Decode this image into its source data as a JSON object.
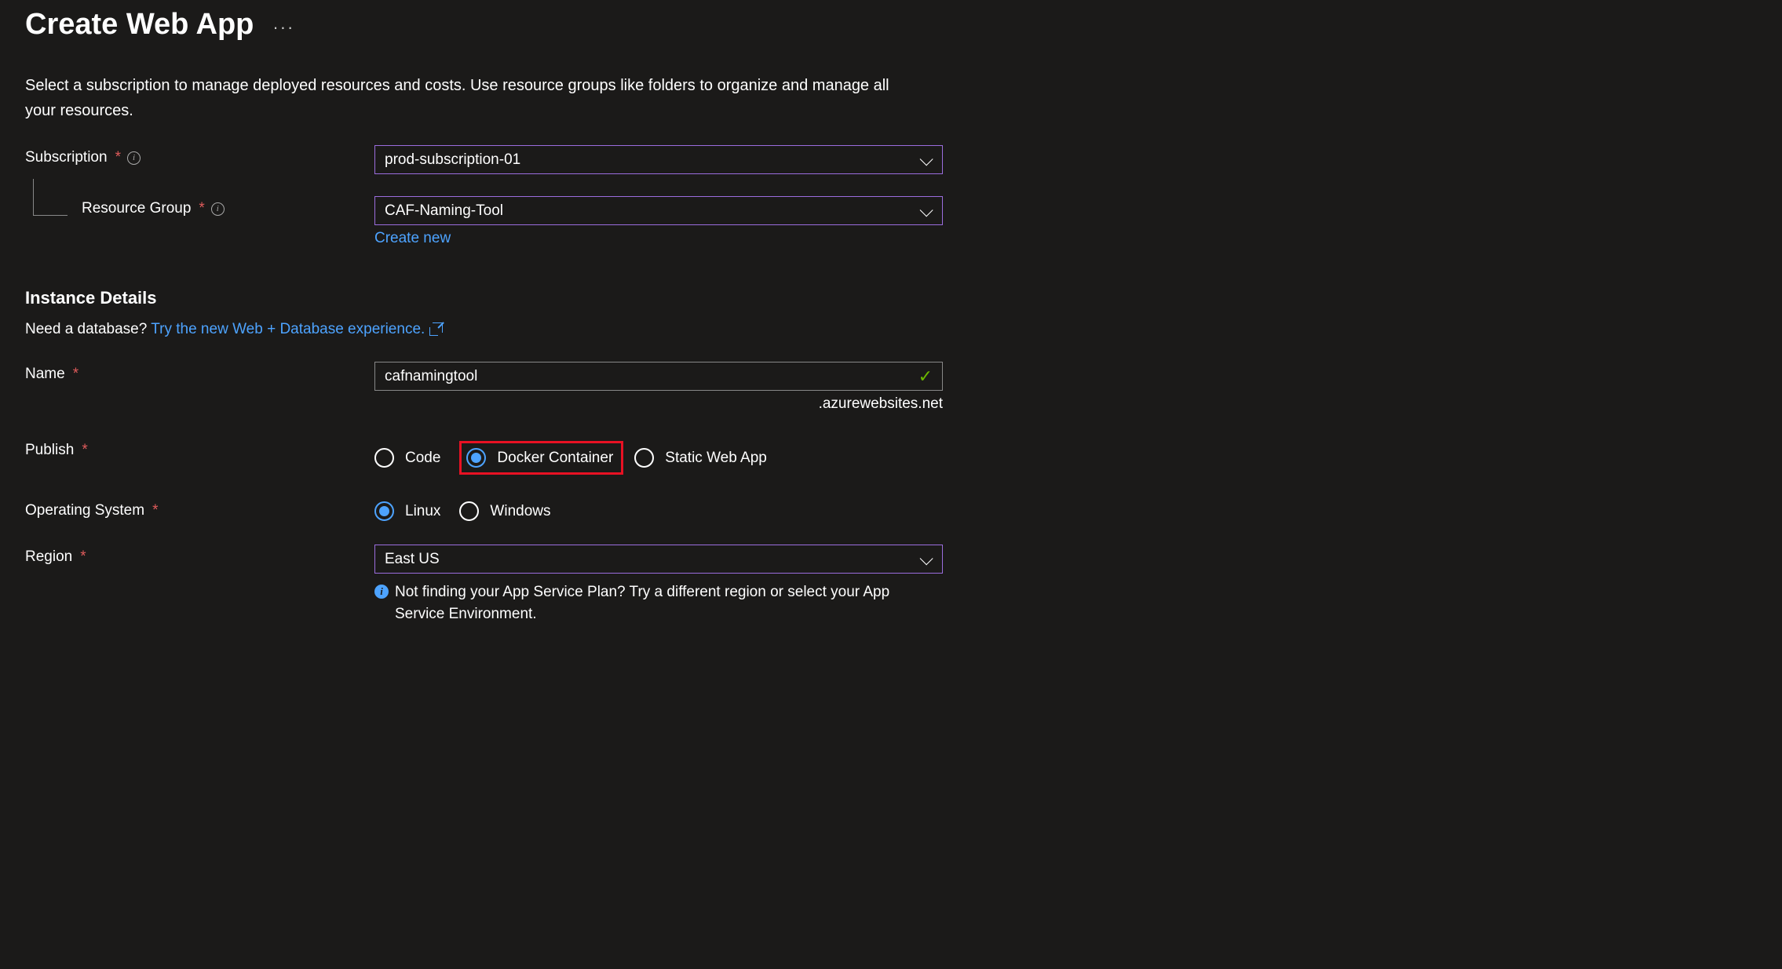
{
  "header": {
    "title": "Create Web App"
  },
  "intro": "Select a subscription to manage deployed resources and costs. Use resource groups like folders to organize and manage all your resources.",
  "fields": {
    "subscription": {
      "label": "Subscription",
      "value": "prod-subscription-01"
    },
    "resource_group": {
      "label": "Resource Group",
      "value": "CAF-Naming-Tool",
      "create_new": "Create new"
    }
  },
  "instance": {
    "section_title": "Instance Details",
    "db_prompt": "Need a database?",
    "db_link": "Try the new Web + Database experience.",
    "name": {
      "label": "Name",
      "value": "cafnamingtool",
      "suffix": ".azurewebsites.net"
    },
    "publish": {
      "label": "Publish",
      "options": {
        "code": "Code",
        "docker": "Docker Container",
        "static": "Static Web App"
      }
    },
    "os": {
      "label": "Operating System",
      "options": {
        "linux": "Linux",
        "windows": "Windows"
      }
    },
    "region": {
      "label": "Region",
      "value": "East US",
      "hint": "Not finding your App Service Plan? Try a different region or select your App Service Environment."
    }
  }
}
